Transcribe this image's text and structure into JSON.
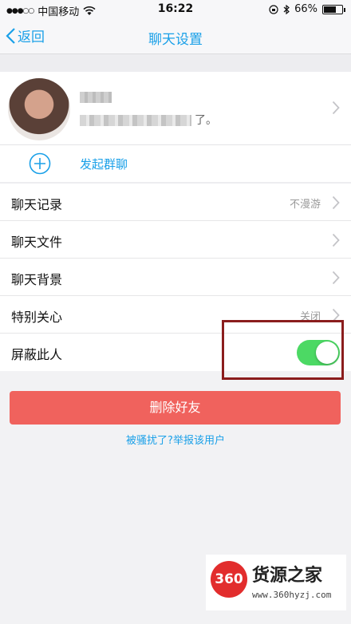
{
  "status": {
    "carrier": "中国移动",
    "time": "16:22",
    "battery": "66%",
    "battery_level": 0.66
  },
  "nav": {
    "back_label": "返回",
    "title": "聊天设置"
  },
  "profile": {
    "signature_tail": "了。"
  },
  "group": {
    "label": "发起群聊"
  },
  "settings": [
    {
      "label": "聊天记录",
      "value": "不漫游"
    },
    {
      "label": "聊天文件",
      "value": ""
    },
    {
      "label": "聊天背景",
      "value": ""
    },
    {
      "label": "特别关心",
      "value": "关闭"
    },
    {
      "label": "屏蔽此人",
      "toggle_on": true
    }
  ],
  "actions": {
    "delete_label": "删除好友",
    "report_label": "被骚扰了?举报该用户"
  },
  "watermark": {
    "logo": "360",
    "title": "货源之家",
    "url": "www.360hyzj.com"
  },
  "colors": {
    "accent": "#1aa0e8",
    "danger": "#f0625d",
    "toggle_on": "#4cd964",
    "highlight_box": "#8b1d1d"
  },
  "icons": [
    "signal-dots-icon",
    "wifi-icon",
    "lock-rotation-icon",
    "bluetooth-icon",
    "battery-icon",
    "back-chevron-icon",
    "chevron-right-icon",
    "add-circle-icon"
  ]
}
